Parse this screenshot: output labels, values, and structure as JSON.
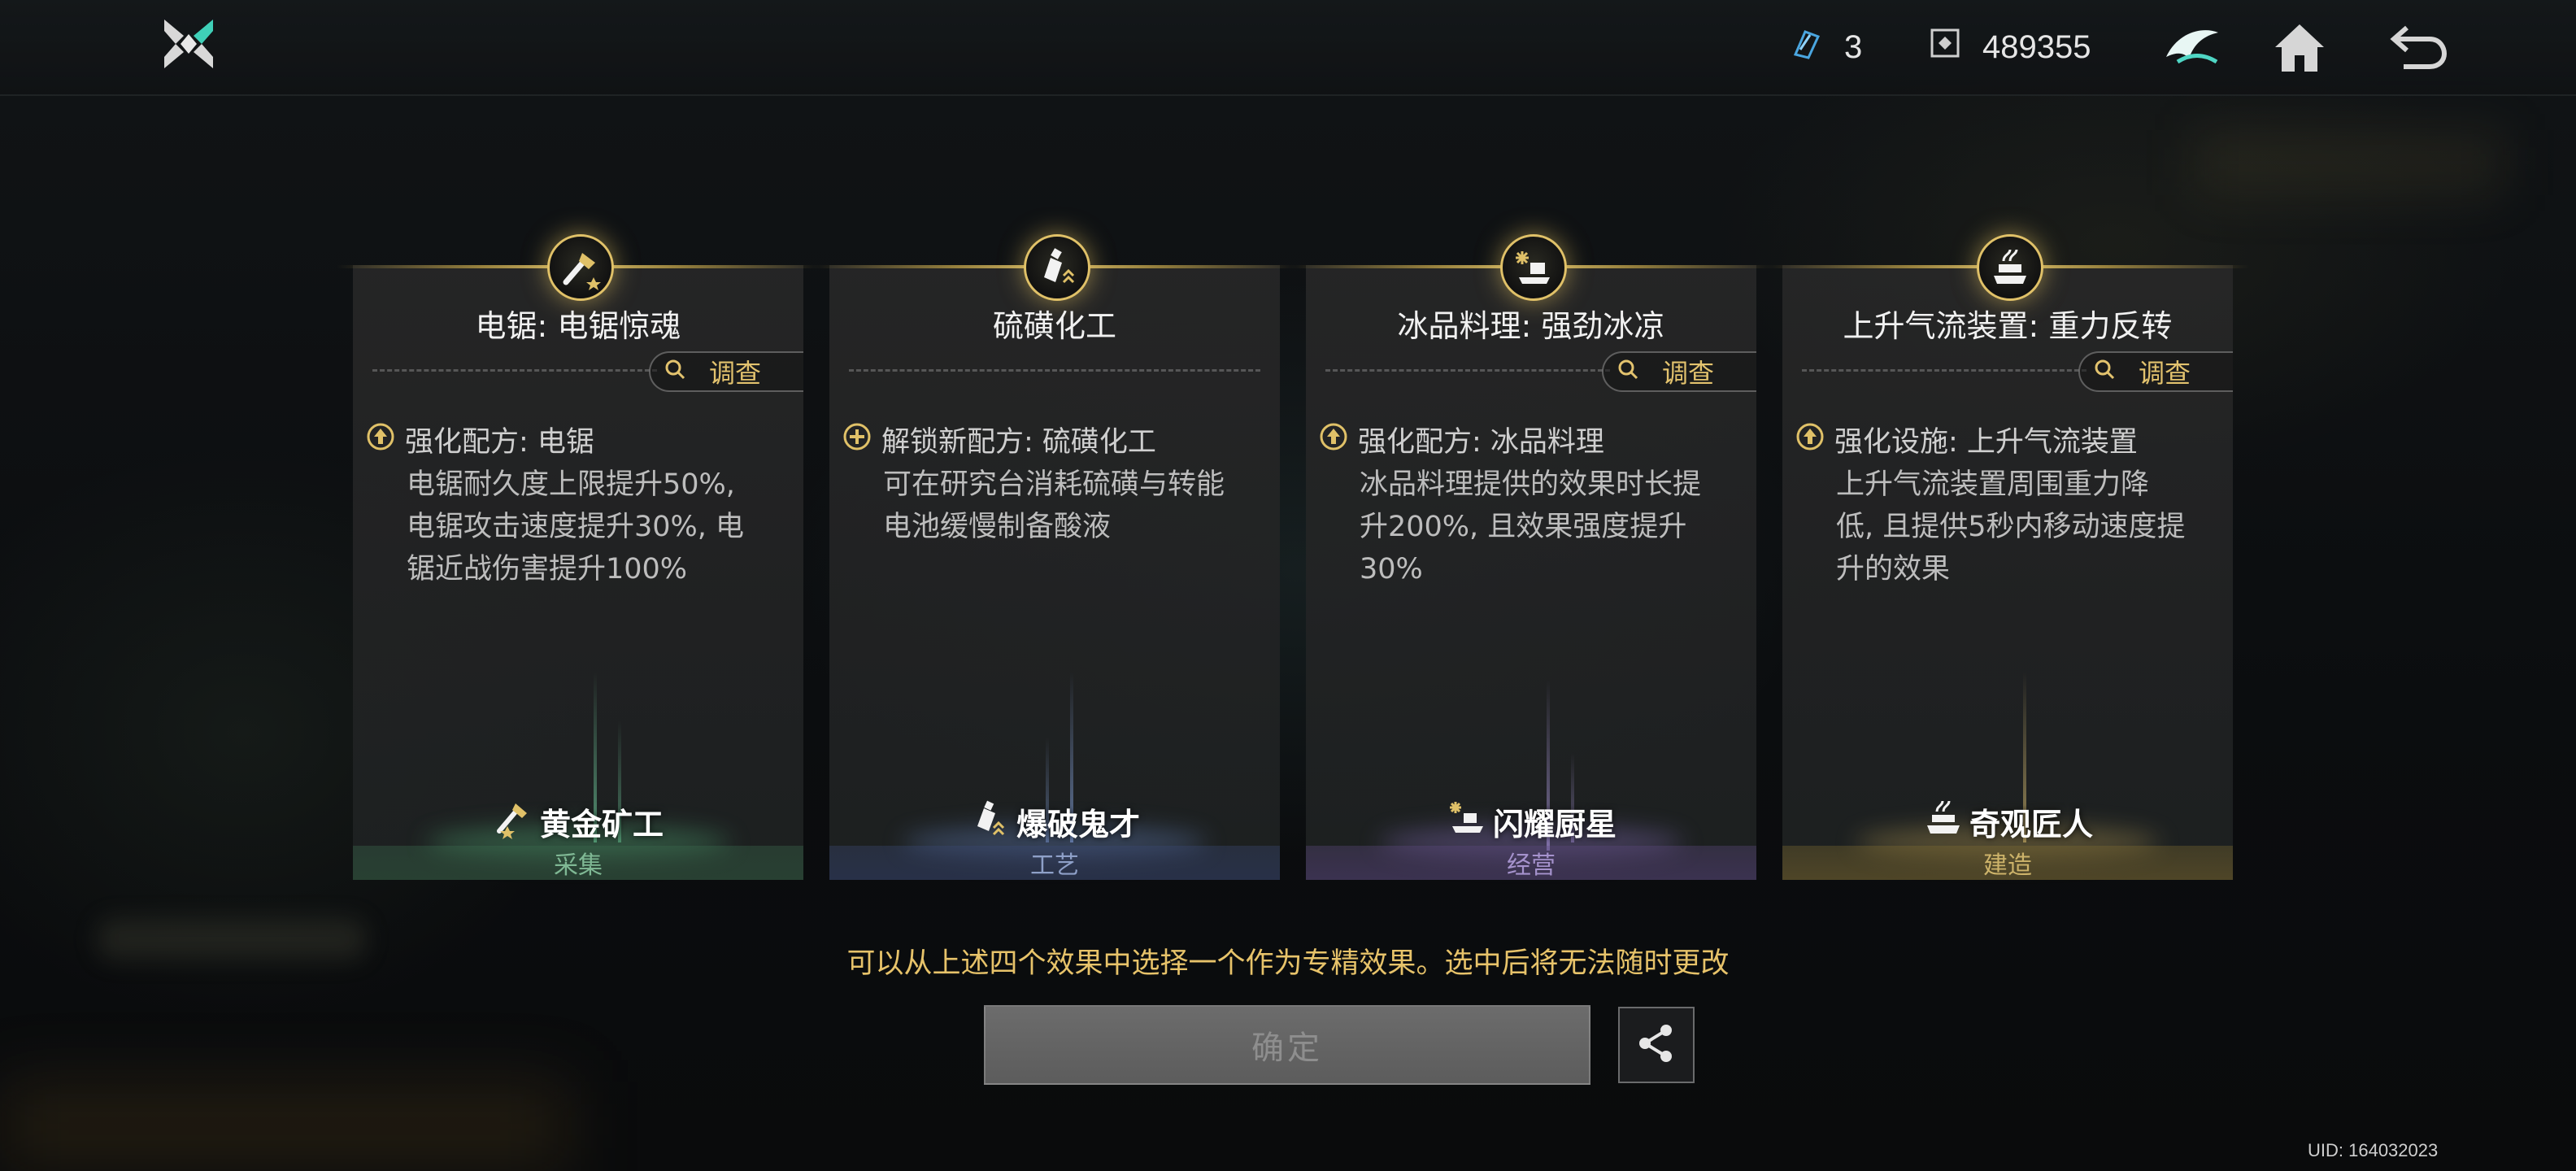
{
  "topbar": {
    "logo_icon": "game-logo-icon",
    "resources": [
      {
        "icon": "crystal-shard-icon",
        "value": "3"
      },
      {
        "icon": "currency-token-icon",
        "value": "489355"
      }
    ],
    "buttons": [
      "emblem-icon",
      "home-icon",
      "back-icon"
    ]
  },
  "cards": [
    {
      "title": "电锯: 电锯惊魂",
      "emblem_icon": "chainsaw-icon",
      "investigate_label": "调查",
      "effect_type_icon": "upgrade-icon",
      "effect_head": "强化配方: 电锯",
      "effect_body": "电锯耐久度上限提升50%,\n电锯攻击速度提升30%, 电\n锯近战伤害提升100%",
      "badge_label": "黄金矿工",
      "badge_icon": "chainsaw-star-icon",
      "category": "采集",
      "category_color": "#6fae86"
    },
    {
      "title": "硫磺化工",
      "emblem_icon": "bottle-icon",
      "investigate_label": "",
      "effect_type_icon": "unlock-plus-icon",
      "effect_head": "解锁新配方: 硫磺化工",
      "effect_body": "可在研究台消耗硫磺与转能\n电池缓慢制备酸液",
      "badge_label": "爆破鬼才",
      "badge_icon": "bottle-rank-icon",
      "category": "工艺",
      "category_color": "#7d8fb8"
    },
    {
      "title": "冰品料理: 强劲冰凉",
      "emblem_icon": "ice-dish-icon",
      "investigate_label": "调查",
      "effect_type_icon": "upgrade-icon",
      "effect_head": "强化配方: 冰品料理",
      "effect_body": "冰品料理提供的效果时长提\n升200%, 且效果强度提升\n30%",
      "badge_label": "闪耀厨星",
      "badge_icon": "ice-dish-icon",
      "category": "经营",
      "category_color": "#9b84c4"
    },
    {
      "title": "上升气流装置: 重力反转",
      "emblem_icon": "updraft-device-icon",
      "investigate_label": "调查",
      "effect_type_icon": "upgrade-icon",
      "effect_head": "强化设施: 上升气流装置",
      "effect_body": "上升气流装置周围重力降\n低, 且提供5秒内移动速度提\n升的效果",
      "badge_label": "奇观匠人",
      "badge_icon": "updraft-device-icon",
      "category": "建造",
      "category_color": "#c8aa5a"
    }
  ],
  "hint": "可以从上述四个效果中选择一个作为专精效果。选中后将无法随时更改",
  "confirm_label": "确定",
  "share_icon": "share-icon",
  "uid": "UID: 164032023"
}
